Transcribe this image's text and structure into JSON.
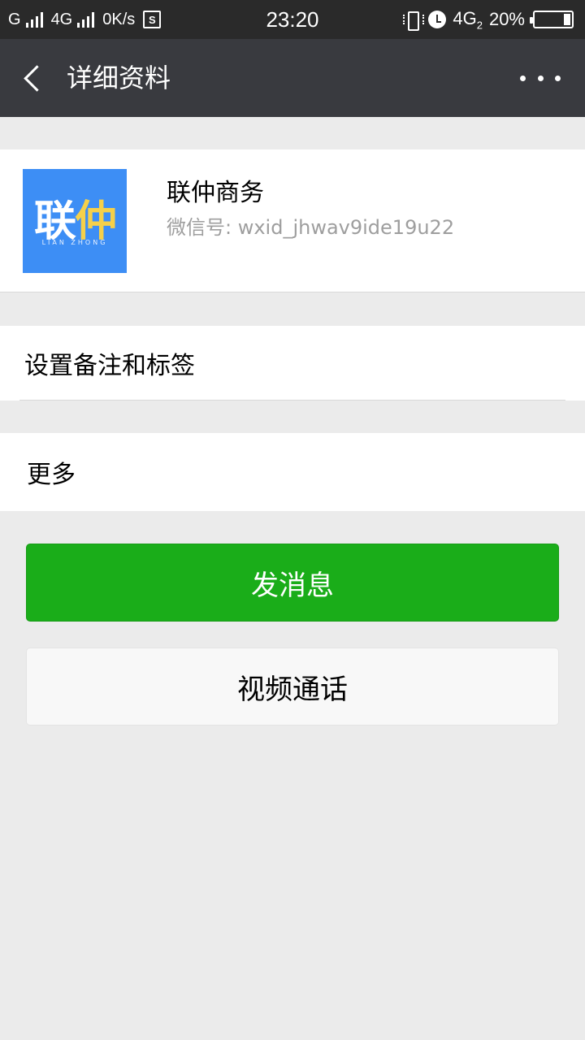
{
  "status_bar": {
    "carrier1": "G",
    "carrier2": "4G",
    "speed": "0K/s",
    "sd_icon": "S",
    "time": "23:20",
    "network": "4G",
    "network_sub": "2",
    "battery_percent": "20%",
    "battery_level": 0.2
  },
  "header": {
    "back_icon": "chevron-left-icon",
    "title": "详细资料",
    "more_icon": "more-horizontal-icon"
  },
  "profile": {
    "avatar_text_main": "联",
    "avatar_text_accent": "仲",
    "avatar_subtext": "LIAN ZHONG",
    "name": "联仲商务",
    "wechat_id": "微信号: wxid_jhwav9ide19u22"
  },
  "cells": {
    "remark_label": "设置备注和标签",
    "more_label": "更多"
  },
  "actions": {
    "send_message": "发消息",
    "video_call": "视频通话"
  },
  "colors": {
    "header_bg": "#393a3f",
    "primary_green": "#1aad19",
    "page_bg": "#ebebeb",
    "avatar_blue": "#3d8ef5"
  }
}
